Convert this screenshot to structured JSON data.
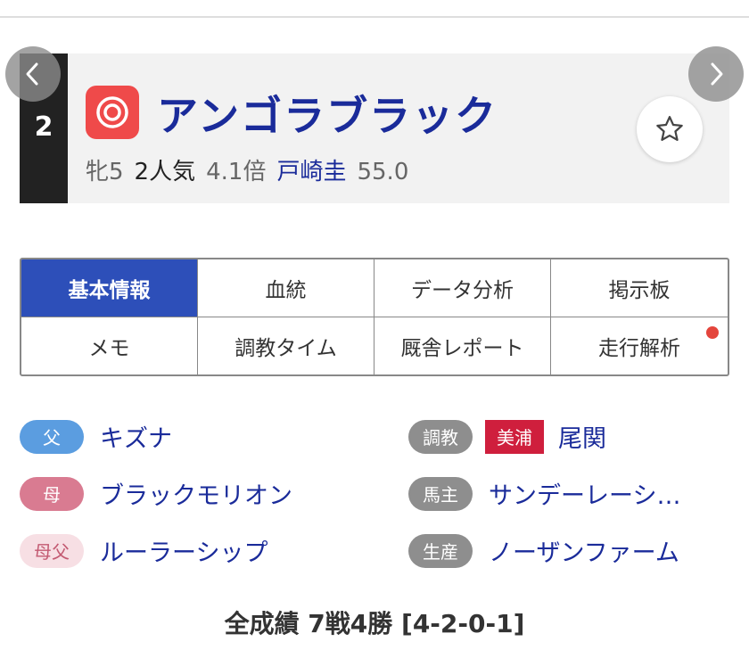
{
  "card": {
    "gate_number": "2",
    "horse_name": "アンゴラブラック",
    "sex_age": "牝5",
    "popularity": "2人気",
    "odds": "4.1倍",
    "jockey": "戸崎圭",
    "weight": "55.0"
  },
  "tabs": [
    {
      "label": "基本情報"
    },
    {
      "label": "血統"
    },
    {
      "label": "データ分析"
    },
    {
      "label": "掲示板"
    },
    {
      "label": "メモ"
    },
    {
      "label": "調教タイム"
    },
    {
      "label": "厩舎レポート"
    },
    {
      "label": "走行解析"
    }
  ],
  "pedigree": {
    "father": {
      "badge": "父",
      "value": "キズナ"
    },
    "mother": {
      "badge": "母",
      "value": "ブラックモリオン"
    },
    "mother_father": {
      "badge": "母父",
      "value": "ルーラーシップ"
    }
  },
  "connections": {
    "trainer": {
      "badge": "調教",
      "area": "美浦",
      "value": "尾関"
    },
    "owner": {
      "badge": "馬主",
      "value": "サンデーレーシ…"
    },
    "breeder": {
      "badge": "生産",
      "value": "ノーザンファーム"
    }
  },
  "record": "全成績 7戦4勝 [4-2-0-1]",
  "colors": {
    "brand_blue": "#1a2b9a",
    "active_tab": "#2d4fb9",
    "mark_red": "#ef4a4a",
    "area_red": "#cf1f3d",
    "notification_dot": "#e4453c"
  }
}
